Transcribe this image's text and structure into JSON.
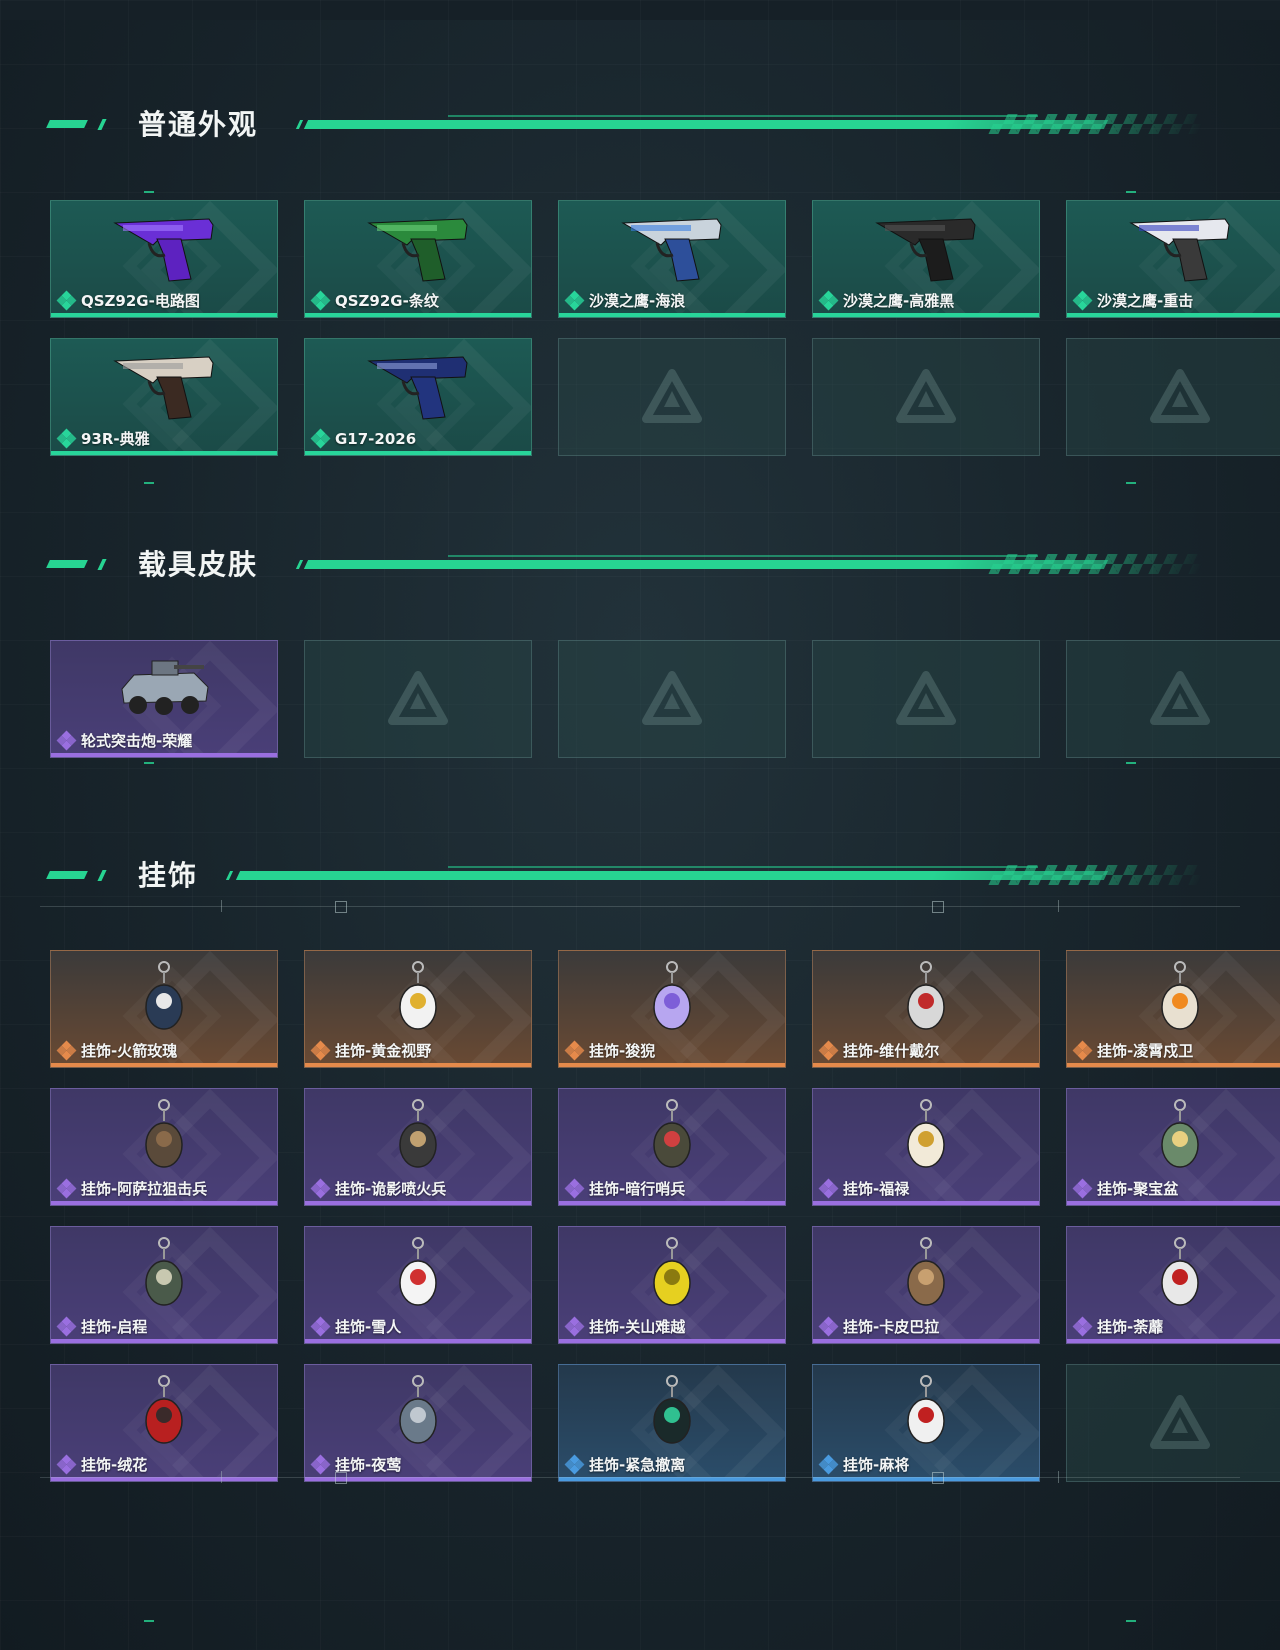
{
  "sections": {
    "weapon_skins": {
      "title": "普通外观",
      "items": [
        {
          "label": "QSZ92G-电路图",
          "rarity": "green",
          "icon": "purple-pistol-icon"
        },
        {
          "label": "QSZ92G-条纹",
          "rarity": "green",
          "icon": "green-camo-pistol-icon"
        },
        {
          "label": "沙漠之鹰-海浪",
          "rarity": "green",
          "icon": "blue-wave-pistol-icon"
        },
        {
          "label": "沙漠之鹰-高雅黑",
          "rarity": "green",
          "icon": "black-pistol-icon"
        },
        {
          "label": "沙漠之鹰-重击",
          "rarity": "green",
          "icon": "white-blue-pistol-icon"
        },
        {
          "label": "93R-典雅",
          "rarity": "green",
          "icon": "tan-pistol-icon"
        },
        {
          "label": "G17-2026",
          "rarity": "green",
          "icon": "navy-pistol-icon"
        }
      ],
      "empty_slots": 3
    },
    "vehicle_skins": {
      "title": "载具皮肤",
      "items": [
        {
          "label": "轮式突击炮-荣耀",
          "rarity": "purple",
          "icon": "armored-vehicle-icon"
        }
      ],
      "empty_slots": 4
    },
    "charms": {
      "title": "挂饰",
      "items": [
        {
          "label": "挂饰-火箭玫瑰",
          "rarity": "orange",
          "icon": "rocket-rose-charm-icon"
        },
        {
          "label": "挂饰-黄金视野",
          "rarity": "orange",
          "icon": "golden-vision-charm-icon"
        },
        {
          "label": "挂饰-狻猊",
          "rarity": "orange",
          "icon": "suanni-charm-icon"
        },
        {
          "label": "挂饰-维什戴尔",
          "rarity": "orange",
          "icon": "wisdel-charm-icon"
        },
        {
          "label": "挂饰-凌霄戍卫",
          "rarity": "orange",
          "icon": "sky-guard-charm-icon"
        },
        {
          "label": "挂饰-阿萨拉狙击兵",
          "rarity": "purple",
          "icon": "sniper-charm-icon"
        },
        {
          "label": "挂饰-诡影喷火兵",
          "rarity": "purple",
          "icon": "flamer-charm-icon"
        },
        {
          "label": "挂饰-暗行哨兵",
          "rarity": "purple",
          "icon": "sentry-charm-icon"
        },
        {
          "label": "挂饰-福禄",
          "rarity": "purple",
          "icon": "gourd-charm-icon"
        },
        {
          "label": "挂饰-聚宝盆",
          "rarity": "purple",
          "icon": "treasure-bowl-charm-icon"
        },
        {
          "label": "挂饰-启程",
          "rarity": "purple",
          "icon": "departure-charm-icon"
        },
        {
          "label": "挂饰-雪人",
          "rarity": "purple",
          "icon": "snowman-charm-icon"
        },
        {
          "label": "挂饰-关山难越",
          "rarity": "purple",
          "icon": "yellow-bar-charm-icon"
        },
        {
          "label": "挂饰-卡皮巴拉",
          "rarity": "purple",
          "icon": "capybara-charm-icon"
        },
        {
          "label": "挂饰-荼蘼",
          "rarity": "purple",
          "icon": "flower-bird-charm-icon"
        },
        {
          "label": "挂饰-绒花",
          "rarity": "purple",
          "icon": "red-flower-charm-icon"
        },
        {
          "label": "挂饰-夜莺",
          "rarity": "purple",
          "icon": "nightingale-charm-icon"
        },
        {
          "label": "挂饰-紧急撤离",
          "rarity": "blue",
          "icon": "emergency-exit-charm-icon"
        },
        {
          "label": "挂饰-麻将",
          "rarity": "blue",
          "icon": "mahjong-charm-icon"
        }
      ],
      "empty_slots": 1
    }
  },
  "rarity_colors": {
    "green": "#28d59a",
    "purple": "#9a6fe0",
    "orange": "#e58a4b",
    "blue": "#4a9be0"
  }
}
